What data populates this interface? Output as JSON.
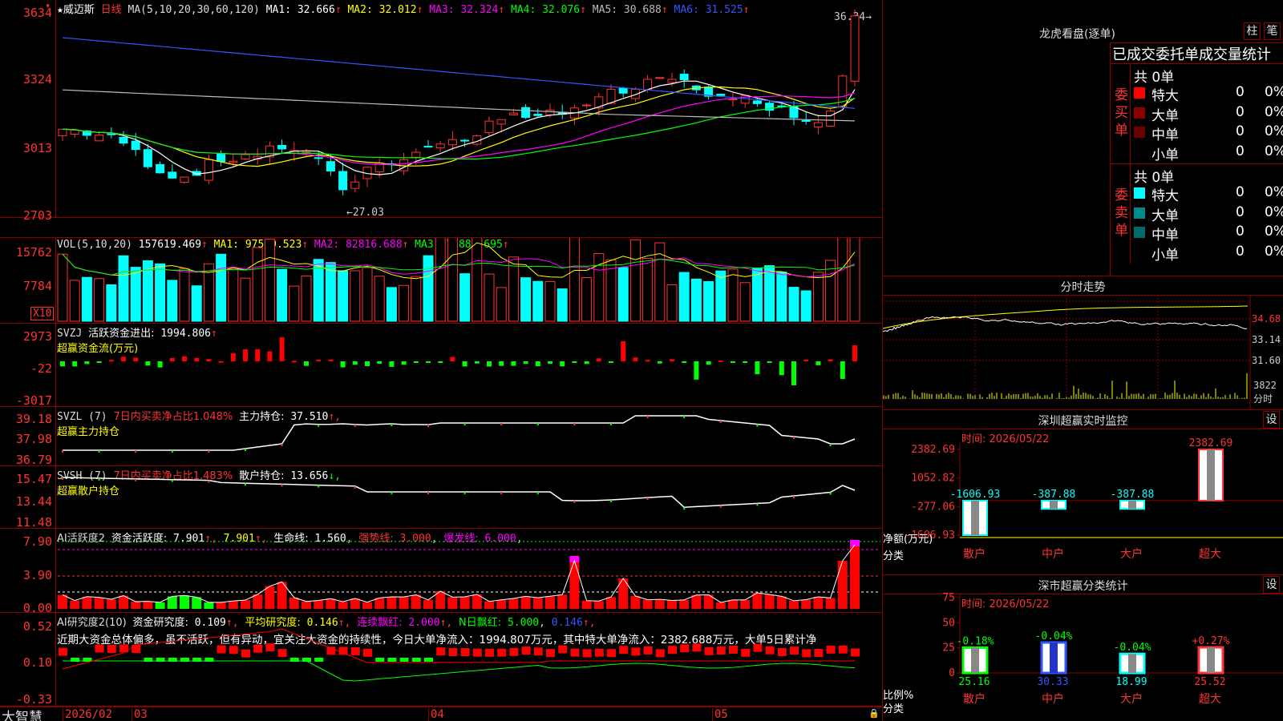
{
  "stock": {
    "name": "威迈斯",
    "period": "日线",
    "star": "★"
  },
  "ma": {
    "label": "MA(5,10,20,30,60,120)",
    "items": [
      {
        "name": "MA1:",
        "value": "32.666",
        "color": "#ffffff"
      },
      {
        "name": "MA2:",
        "value": "32.012",
        "color": "#ffff00"
      },
      {
        "name": "MA3:",
        "value": "32.324",
        "color": "#ff00ff"
      },
      {
        "name": "MA4:",
        "value": "32.076",
        "color": "#00ff00"
      },
      {
        "name": "MA5:",
        "value": "30.688",
        "color": "#bbbbbb"
      },
      {
        "name": "MA6:",
        "value": "31.525",
        "color": "#3355ff"
      }
    ],
    "arrow": "↑"
  },
  "price": {
    "high_label": "36.34",
    "low_label": "←27.03",
    "yticks": [
      "3634",
      "3324",
      "3013",
      "2703"
    ]
  },
  "vol": {
    "label": "VOL(5,10,20)",
    "value": "157619.469",
    "arrow": "↑",
    "items": [
      {
        "name": "MA1:",
        "value": "97599.523",
        "color": "#ffff00"
      },
      {
        "name": "MA2:",
        "value": "82816.688",
        "color": "#ff00ff"
      },
      {
        "name": "MA3:",
        "value": "71889.695",
        "color": "#00ff00"
      }
    ],
    "yticks": [
      "15762",
      "7784"
    ],
    "unit": "X10"
  },
  "svzj": {
    "label": "SVZJ",
    "name": "活跃资金进出:",
    "value": "1994.806",
    "arrow": "↑",
    "sub": "超赢资金流(万元)",
    "yticks": [
      "2973",
      "-22",
      "-3017"
    ]
  },
  "svzl": {
    "label": "SVZL (7)",
    "desc": "7日内买卖净占比1.048%",
    "name": "主力持仓:",
    "value": "37.510",
    "arrow": "↑,",
    "sub": "超赢主力持仓",
    "yticks": [
      "39.18",
      "37.98",
      "36.79"
    ]
  },
  "svsh": {
    "label": "SVSH (7)",
    "desc": "7日内买卖净占比1.483%",
    "name": "散户持仓:",
    "value": "13.656",
    "arrow": "↓,",
    "sub": "超赢散户持仓",
    "yticks": [
      "15.47",
      "13.44",
      "11.48"
    ]
  },
  "ai1": {
    "label": "AI活跃度2",
    "name": "资金活跃度:",
    "value": "7.901",
    "v2": "7.901",
    "life": "生命线:",
    "lifev": "1.560",
    "strong": "强势线:",
    "strongv": "3.000",
    "burst": "爆发线:",
    "burstv": "6.000",
    "yticks": [
      "7.90",
      "3.90",
      "0.00"
    ]
  },
  "ai2": {
    "label": "AI研究度2(10)",
    "name": "资金研究度:",
    "value": "0.109",
    "avg": "平均研究度:",
    "avgv": "0.146",
    "cont": "连续飘红:",
    "contv": "2.000",
    "nday": "N日飘红:",
    "ndayv": "5.000",
    "last": "0.146",
    "comment": "近期大资金总体偏多，虽不活跃，但有异动，宜关注大资金的持续性，今日大单净流入：1994.807万元，其中特大单净流入：2382.688万元，大单5日累计净",
    "yticks": [
      "0.52",
      "0.10",
      "-0.33"
    ]
  },
  "dates": {
    "start": "2026/02",
    "m3": "03",
    "m4": "04",
    "m5": "05"
  },
  "brand": "大智慧",
  "right": {
    "lhb_title": "龙虎看盘(逐单)",
    "btn_zhu": "柱",
    "btn_bi": "笔",
    "header": "已成交委托单成交量统计",
    "buy": {
      "side": "委买单",
      "total": "共 0单",
      "rows": [
        {
          "label": "特大",
          "count": "0",
          "pct": "0%",
          "color": "#ff0000"
        },
        {
          "label": "大单",
          "count": "0",
          "pct": "0%",
          "color": "#8a0000"
        },
        {
          "label": "中单",
          "count": "0",
          "pct": "0%",
          "color": "#6a0000"
        },
        {
          "label": "小单",
          "count": "0",
          "pct": "0%",
          "color": "#000000"
        }
      ]
    },
    "sell": {
      "side": "委卖单",
      "total": "共 0单",
      "rows": [
        {
          "label": "特大",
          "count": "0",
          "pct": "0%",
          "color": "#00ffff"
        },
        {
          "label": "大单",
          "count": "0",
          "pct": "0%",
          "color": "#008b8b"
        },
        {
          "label": "中单",
          "count": "0",
          "pct": "0%",
          "color": "#006a6a"
        },
        {
          "label": "小单",
          "count": "0",
          "pct": "0%",
          "color": "#000000"
        }
      ]
    },
    "fenshi": {
      "title": "分时走势",
      "yticks": [
        "34.68",
        "33.14",
        "31.60"
      ],
      "vol": "3822",
      "unit": "分时"
    },
    "sz_monitor": {
      "title": "深圳超赢实时监控",
      "btn": "设",
      "time": "时间: 2026/05/22",
      "yticks": [
        "2382.69",
        "1052.82",
        "-277.06",
        "-1606.93"
      ],
      "ylabel": "净额(万元)",
      "xlabel": "分类",
      "cats": [
        "散户",
        "中户",
        "大户",
        "超大"
      ],
      "values": [
        -1606.93,
        -387.88,
        -387.88,
        2382.69
      ],
      "labels": [
        "-1606.93",
        "-387.88",
        "-387.88",
        "2382.69"
      ]
    },
    "sz_class": {
      "title": "深市超赢分类统计",
      "btn": "设",
      "time": "时间: 2026/05/22",
      "yticks": [
        "75",
        "50",
        "25",
        "0"
      ],
      "ylabel": "比例%",
      "xlabel": "分类",
      "cats": [
        "散户",
        "中户",
        "大户",
        "超大"
      ],
      "values": [
        25.16,
        30.33,
        18.99,
        25.52
      ],
      "changes": [
        "-0.18%",
        "-0.04%",
        "-0.04%",
        "+0.27%"
      ],
      "vlabels": [
        "25.16",
        "30.33",
        "18.99",
        "25.52"
      ]
    }
  }
}
